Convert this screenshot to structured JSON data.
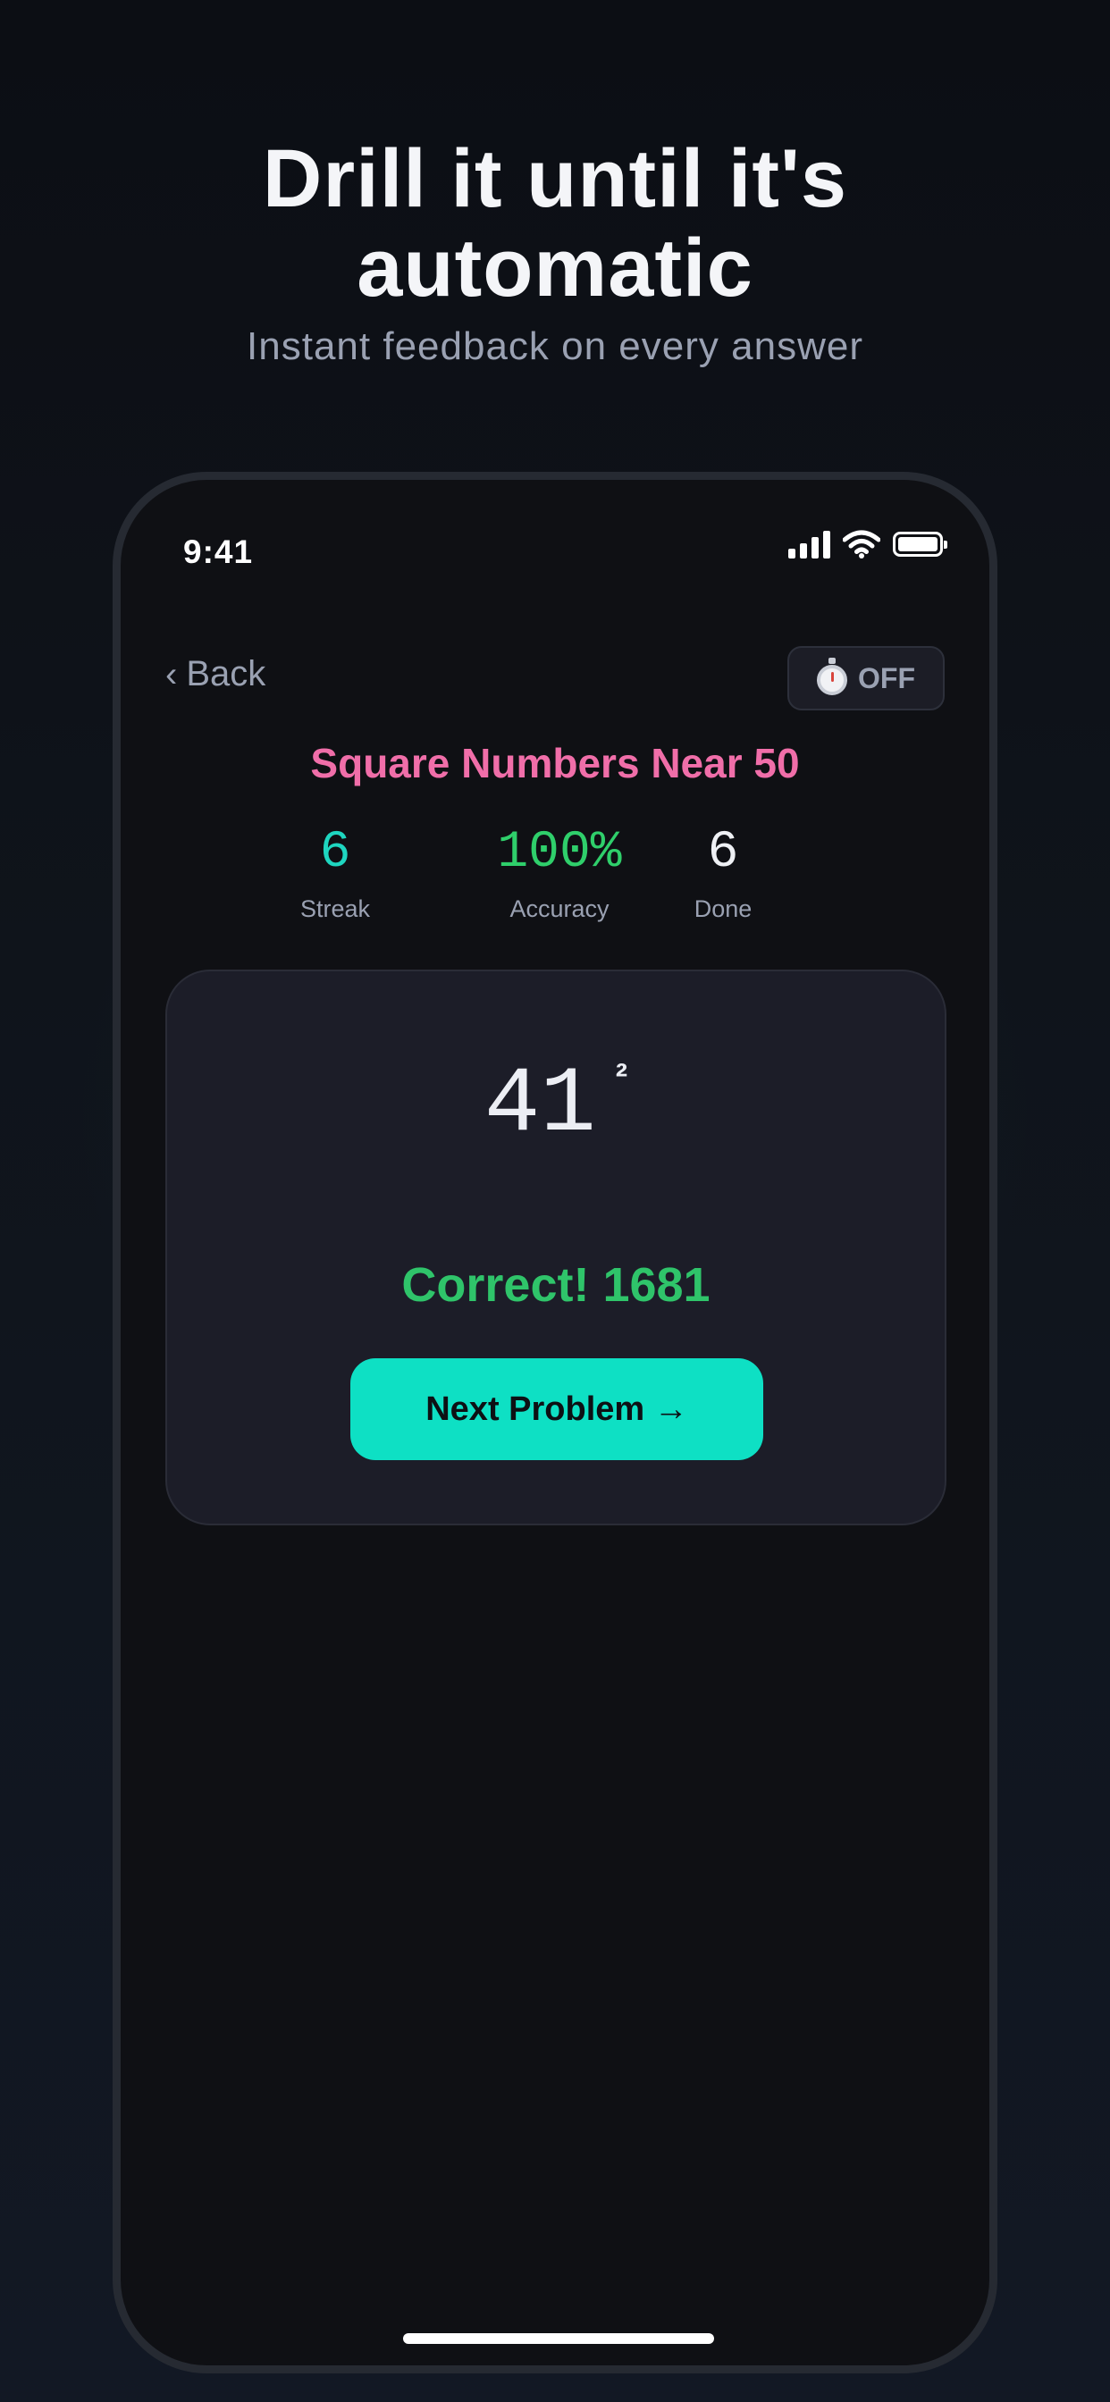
{
  "marketing": {
    "headline_line1": "Drill it until it's",
    "headline_line2": "automatic",
    "subhead": "Instant feedback on every answer"
  },
  "status_bar": {
    "time": "9:41"
  },
  "nav": {
    "back_chevron": "‹",
    "back_label": "Back",
    "timer_label": "OFF"
  },
  "drill": {
    "title": "Square Numbers Near 50"
  },
  "stats": {
    "streak_value": "6",
    "streak_label": "Streak",
    "accuracy_value": "100%",
    "accuracy_label": "Accuracy",
    "done_value": "6",
    "done_label": "Done"
  },
  "problem": {
    "base": "41",
    "exponent": "²",
    "feedback": "Correct! 1681",
    "next_button_label": "Next Problem →"
  },
  "colors": {
    "accent_teal": "#0ee0c4",
    "title_pink": "#f06ea9",
    "success_green": "#2fc46a",
    "card_background": "#1c1d28"
  },
  "icons": {
    "signal": "cellular-signal-icon",
    "wifi": "wifi-icon",
    "battery": "battery-icon",
    "timer": "stopwatch-icon"
  }
}
